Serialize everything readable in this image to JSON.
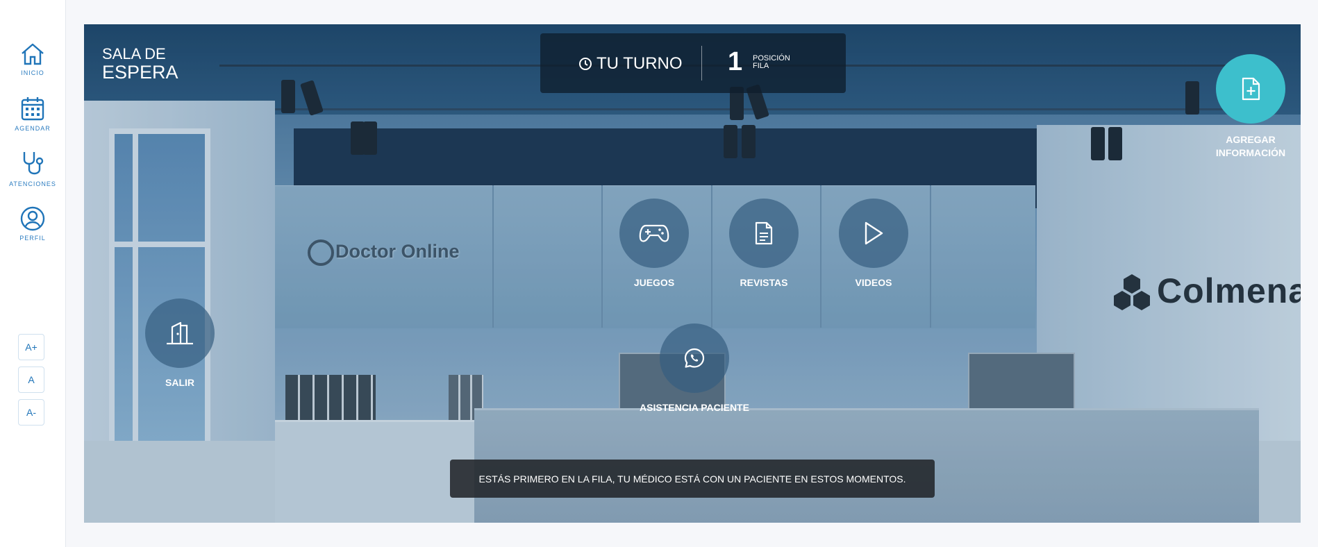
{
  "sidebar": {
    "items": [
      {
        "label": "INICIO",
        "icon": "home-icon"
      },
      {
        "label": "AGENDAR",
        "icon": "calendar-icon"
      },
      {
        "label": "ATENCIONES",
        "icon": "stethoscope-icon"
      },
      {
        "label": "PERFIL",
        "icon": "user-icon"
      }
    ],
    "font_controls": {
      "increase": "A+",
      "normal": "A",
      "decrease": "A-"
    }
  },
  "scene": {
    "title_line1": "SALA DE",
    "title_line2": "ESPERA",
    "turno": {
      "label": "TU TURNO",
      "position": "1",
      "position_label_1": "POSICIÓN",
      "position_label_2": "FILA"
    },
    "actions": {
      "juegos": "JUEGOS",
      "revistas": "REVISTAS",
      "videos": "VIDEOS",
      "asistencia": "ASISTENCIA PACIENTE",
      "salir": "SALIR",
      "agregar_line1": "AGREGAR",
      "agregar_line2": "INFORMACIÓN"
    },
    "brand_left": "Doctor Online",
    "brand_right": "Colmena",
    "message": "ESTÁS PRIMERO EN LA FILA, TU MÉDICO ESTÁ CON UN PACIENTE EN ESTOS MOMENTOS."
  },
  "colors": {
    "accent": "#1f74b8",
    "teal": "#3dbfcc",
    "overlay": "#0e1e2d"
  }
}
